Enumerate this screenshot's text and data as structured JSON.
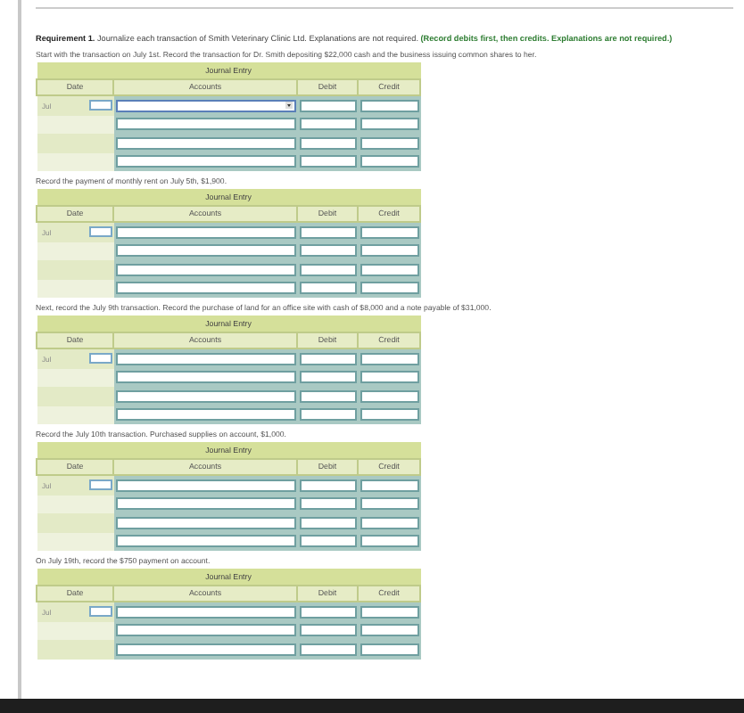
{
  "requirement": {
    "text": "**Requirement 1.** Journalize each transaction of Smith Veterinary Clinic Ltd. Explanations are not required.",
    "note": "(Record debits first, then credits. Explanations are not required.)"
  },
  "sections": [
    {
      "prompt": "Start with the transaction on July 1st. Record the transaction for Dr. Smith depositing $22,000 cash and the business issuing common shares to her.",
      "title": "Journal Entry",
      "columns": [
        "Date",
        "Accounts",
        "Debit",
        "Credit"
      ],
      "rows": [
        {
          "kind": "dated_select",
          "date": "Jul"
        },
        {
          "kind": "plain"
        },
        {
          "kind": "plain"
        },
        {
          "kind": "plain"
        }
      ]
    },
    {
      "prompt": "Record the payment of monthly rent on July 5th, $1,900.",
      "title": "Journal Entry",
      "columns": [
        "Date",
        "Accounts",
        "Debit",
        "Credit"
      ],
      "rows": [
        {
          "kind": "dated",
          "date": "Jul"
        },
        {
          "kind": "plain"
        },
        {
          "kind": "plain"
        },
        {
          "kind": "plain"
        }
      ]
    },
    {
      "prompt": "Next, record the July 9th transaction. Record the purchase of land for an office site with cash of $8,000 and a note payable of $31,000.",
      "title": "Journal Entry",
      "columns": [
        "Date",
        "Accounts",
        "Debit",
        "Credit"
      ],
      "rows": [
        {
          "kind": "dated",
          "date": "Jul"
        },
        {
          "kind": "plain"
        },
        {
          "kind": "plain"
        },
        {
          "kind": "plain"
        }
      ]
    },
    {
      "prompt": "Record the July 10th transaction. Purchased supplies on account, $1,000.",
      "title": "Journal Entry",
      "columns": [
        "Date",
        "Accounts",
        "Debit",
        "Credit"
      ],
      "rows": [
        {
          "kind": "dated",
          "date": "Jul"
        },
        {
          "kind": "plain"
        },
        {
          "kind": "plain"
        },
        {
          "kind": "plain"
        }
      ]
    },
    {
      "prompt": "On July 19th, record the $750 payment on account.",
      "title": "Journal Entry",
      "columns": [
        "Date",
        "Accounts",
        "Debit",
        "Credit"
      ],
      "rows": [
        {
          "kind": "dated",
          "date": "Jul"
        },
        {
          "kind": "plain"
        },
        {
          "kind": "plain"
        }
      ]
    }
  ]
}
